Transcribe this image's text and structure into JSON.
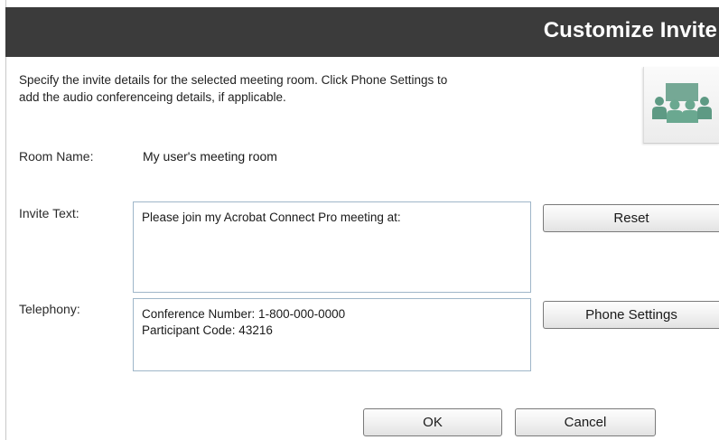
{
  "dialog": {
    "title": "Customize Invite",
    "intro_line1": "Specify the invite details for the selected meeting room.  Click Phone Settings to",
    "intro_line2": "add the audio conferenceing details, if applicable."
  },
  "room": {
    "label": "Room Name:",
    "value": "My user's meeting room",
    "icon": "meeting-room-icon"
  },
  "invite": {
    "label": "Invite Text:",
    "text": "Please join my Acrobat Connect Pro meeting at:",
    "reset_label": "Reset"
  },
  "telephony": {
    "label": "Telephony:",
    "line1": "Conference Number: 1-800-000-0000",
    "line2": "Participant Code: 43216",
    "phone_settings_label": "Phone Settings"
  },
  "footer": {
    "ok_label": "OK",
    "cancel_label": "Cancel"
  },
  "colors": {
    "titlebar": "#3b3b3b",
    "title_text": "#ffffff",
    "textbox_border": "#9fb6c9",
    "icon_green": "#5e9a84"
  }
}
